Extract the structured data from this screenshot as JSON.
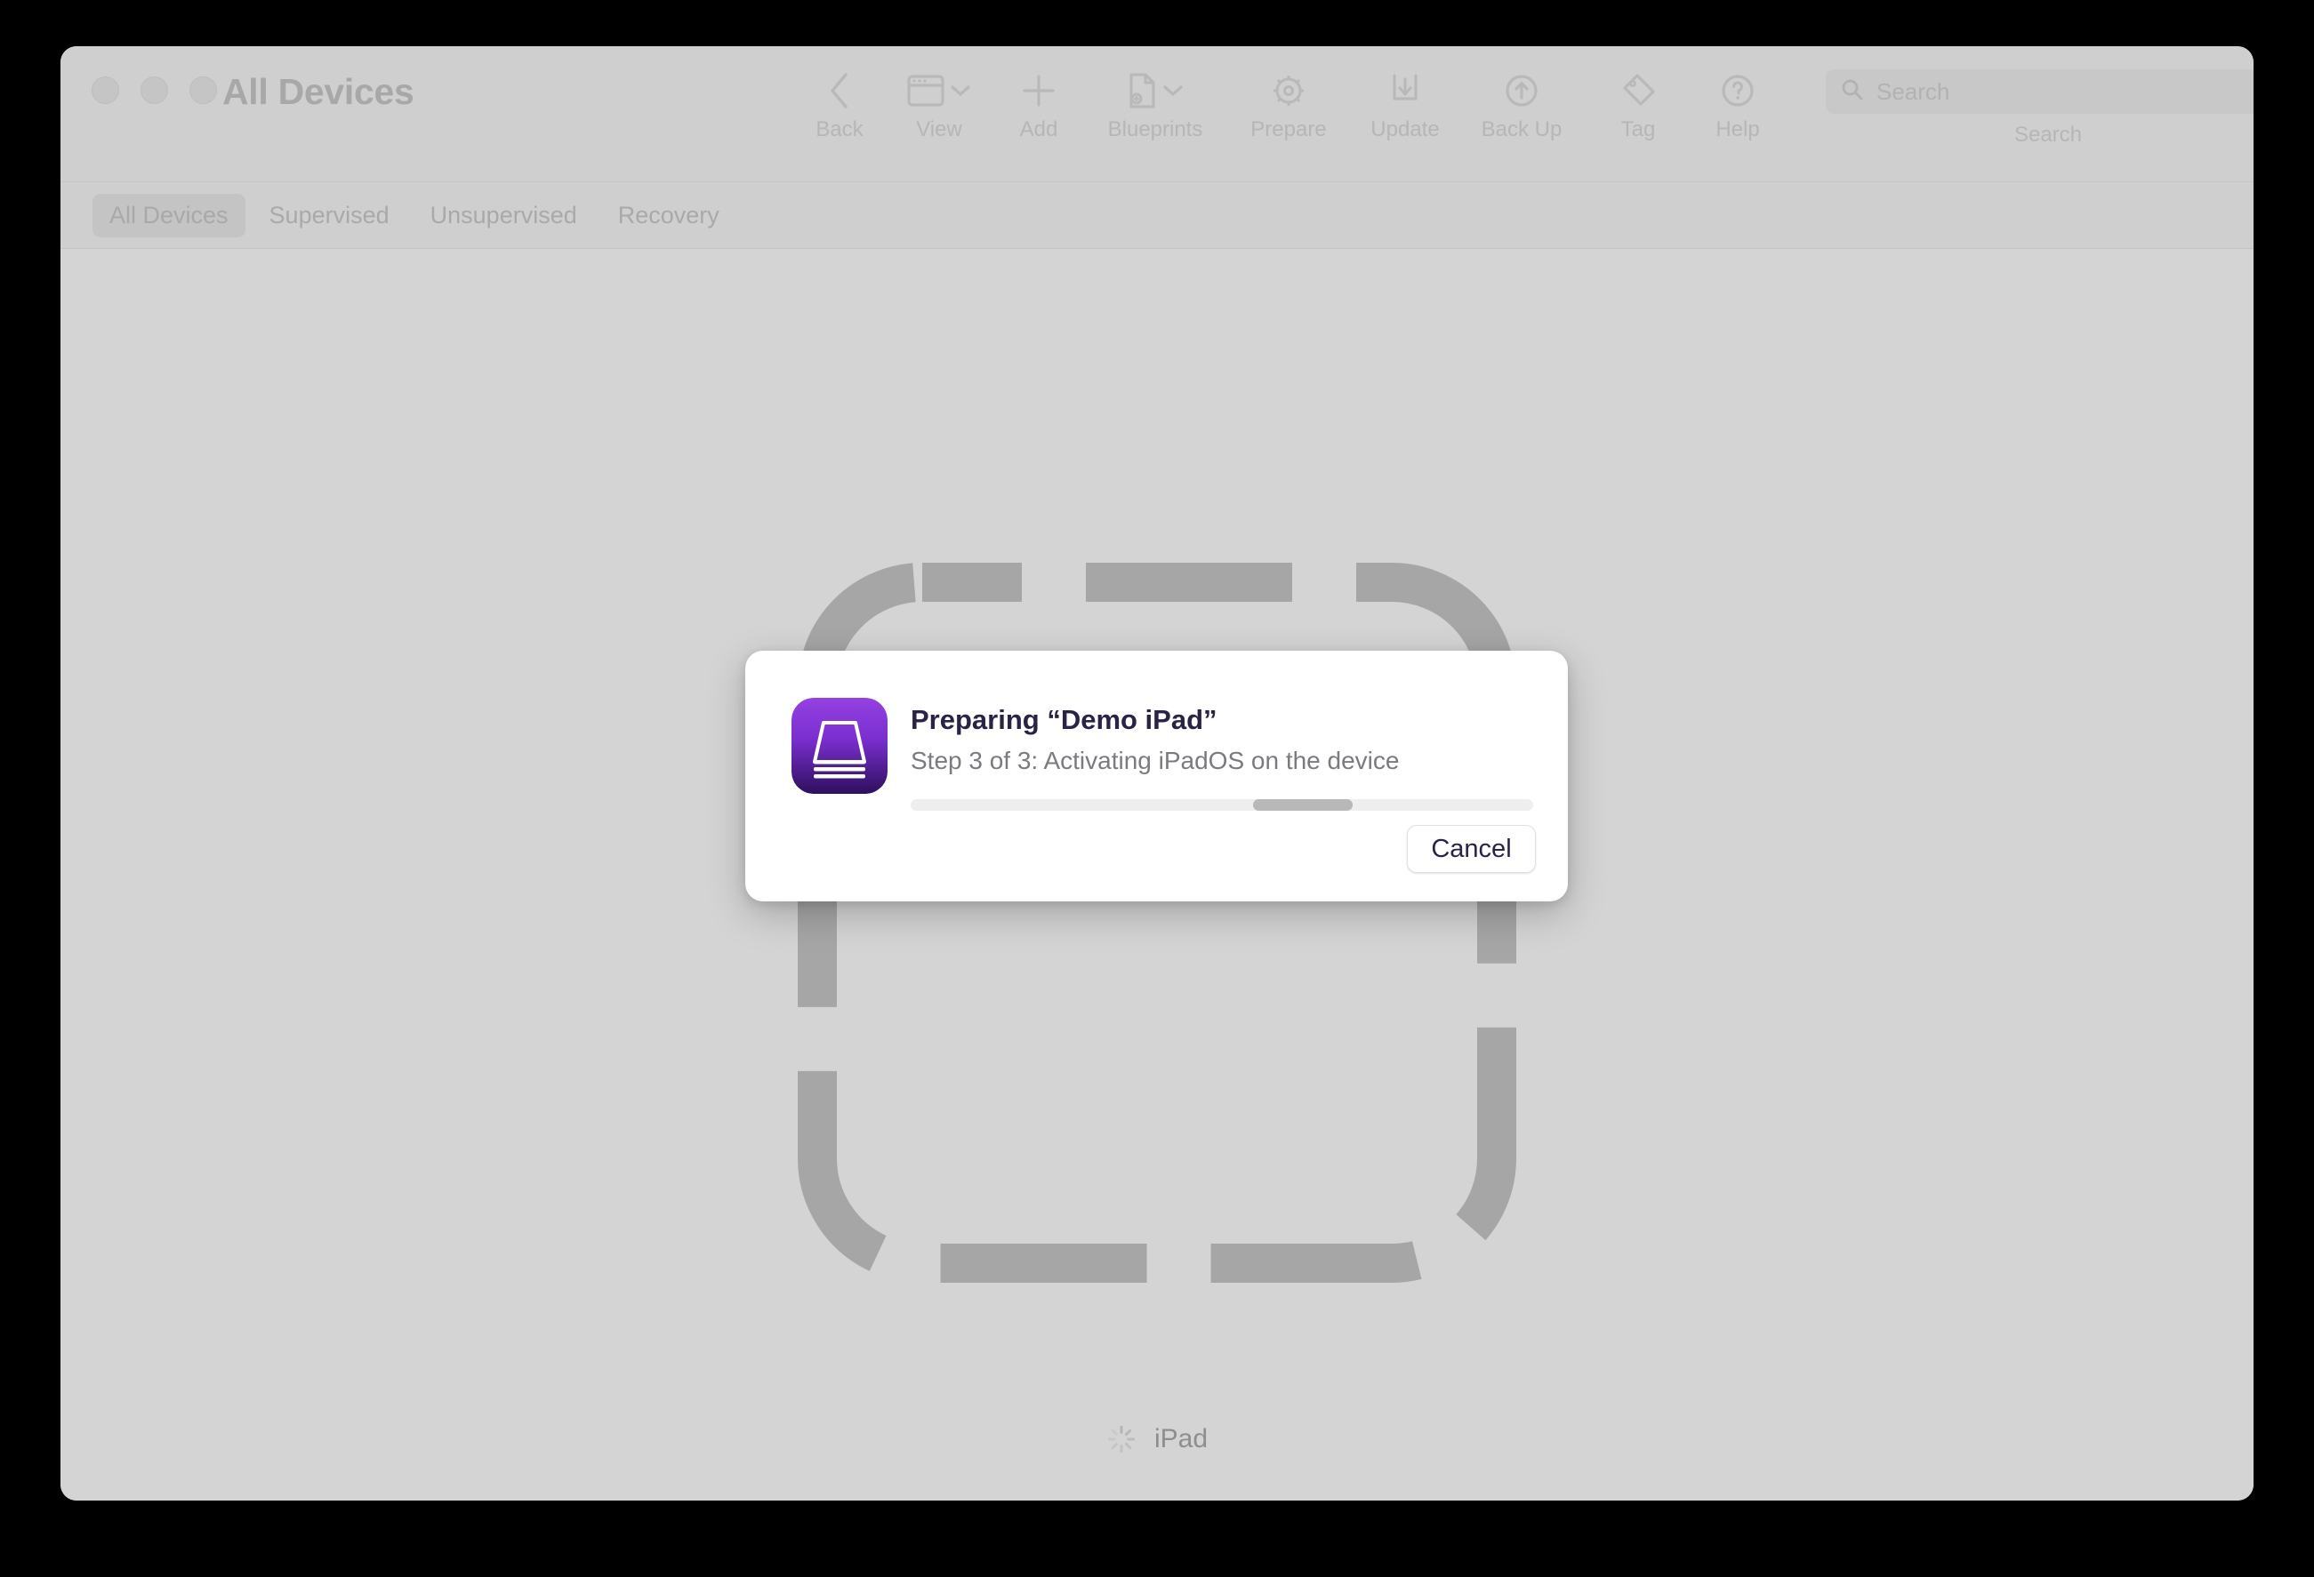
{
  "window": {
    "title": "All Devices",
    "traffic_lights": [
      "close",
      "minimize",
      "zoom"
    ]
  },
  "toolbar": {
    "items": [
      {
        "label": "Back",
        "icon": "chevron-left-icon"
      },
      {
        "label": "View",
        "icon": "window-panel-icon",
        "has_chevron": true
      },
      {
        "label": "Add",
        "icon": "plus-icon"
      },
      {
        "label": "Blueprints",
        "icon": "blueprint-document-icon",
        "has_chevron": true
      },
      {
        "label": "Prepare",
        "icon": "gear-icon"
      },
      {
        "label": "Update",
        "icon": "download-box-icon"
      },
      {
        "label": "Back Up",
        "icon": "arrow-up-circle-icon"
      },
      {
        "label": "Tag",
        "icon": "tag-icon"
      },
      {
        "label": "Help",
        "icon": "question-circle-icon"
      }
    ]
  },
  "search": {
    "placeholder": "Search",
    "value": "",
    "label": "Search",
    "icon": "search-icon"
  },
  "tabs": [
    {
      "label": "All Devices",
      "selected": true
    },
    {
      "label": "Supervised",
      "selected": false
    },
    {
      "label": "Unsupervised",
      "selected": false
    },
    {
      "label": "Recovery",
      "selected": false
    }
  ],
  "content": {
    "device_placeholder_icon": "ipad-outline-placeholder-icon",
    "device_caption": "iPad",
    "spinner_icon": "loading-spinner-icon"
  },
  "dialog": {
    "app_icon": "apple-configurator-icon",
    "title": "Preparing “Demo iPad”",
    "subtitle": "Step 3 of 3: Activating iPadOS on the device",
    "progress": {
      "indeterminate": true,
      "thumb_start_percent": 55,
      "thumb_width_percent": 16
    },
    "cancel_label": "Cancel"
  },
  "colors": {
    "window_chrome": "#cfcfcf",
    "content_background": "#d4d4d4",
    "dialog_background": "#ffffff",
    "dialog_title_text": "#2b2346",
    "dialog_subtitle_text": "#7b7b7f",
    "placeholder_stroke": "#a6a6a6",
    "progress_track": "#eeeeee",
    "progress_thumb": "#b8b8b8",
    "app_icon_purple_light": "#8b35d4",
    "app_icon_purple_dark": "#36126b",
    "desktop_background": "#000000"
  }
}
